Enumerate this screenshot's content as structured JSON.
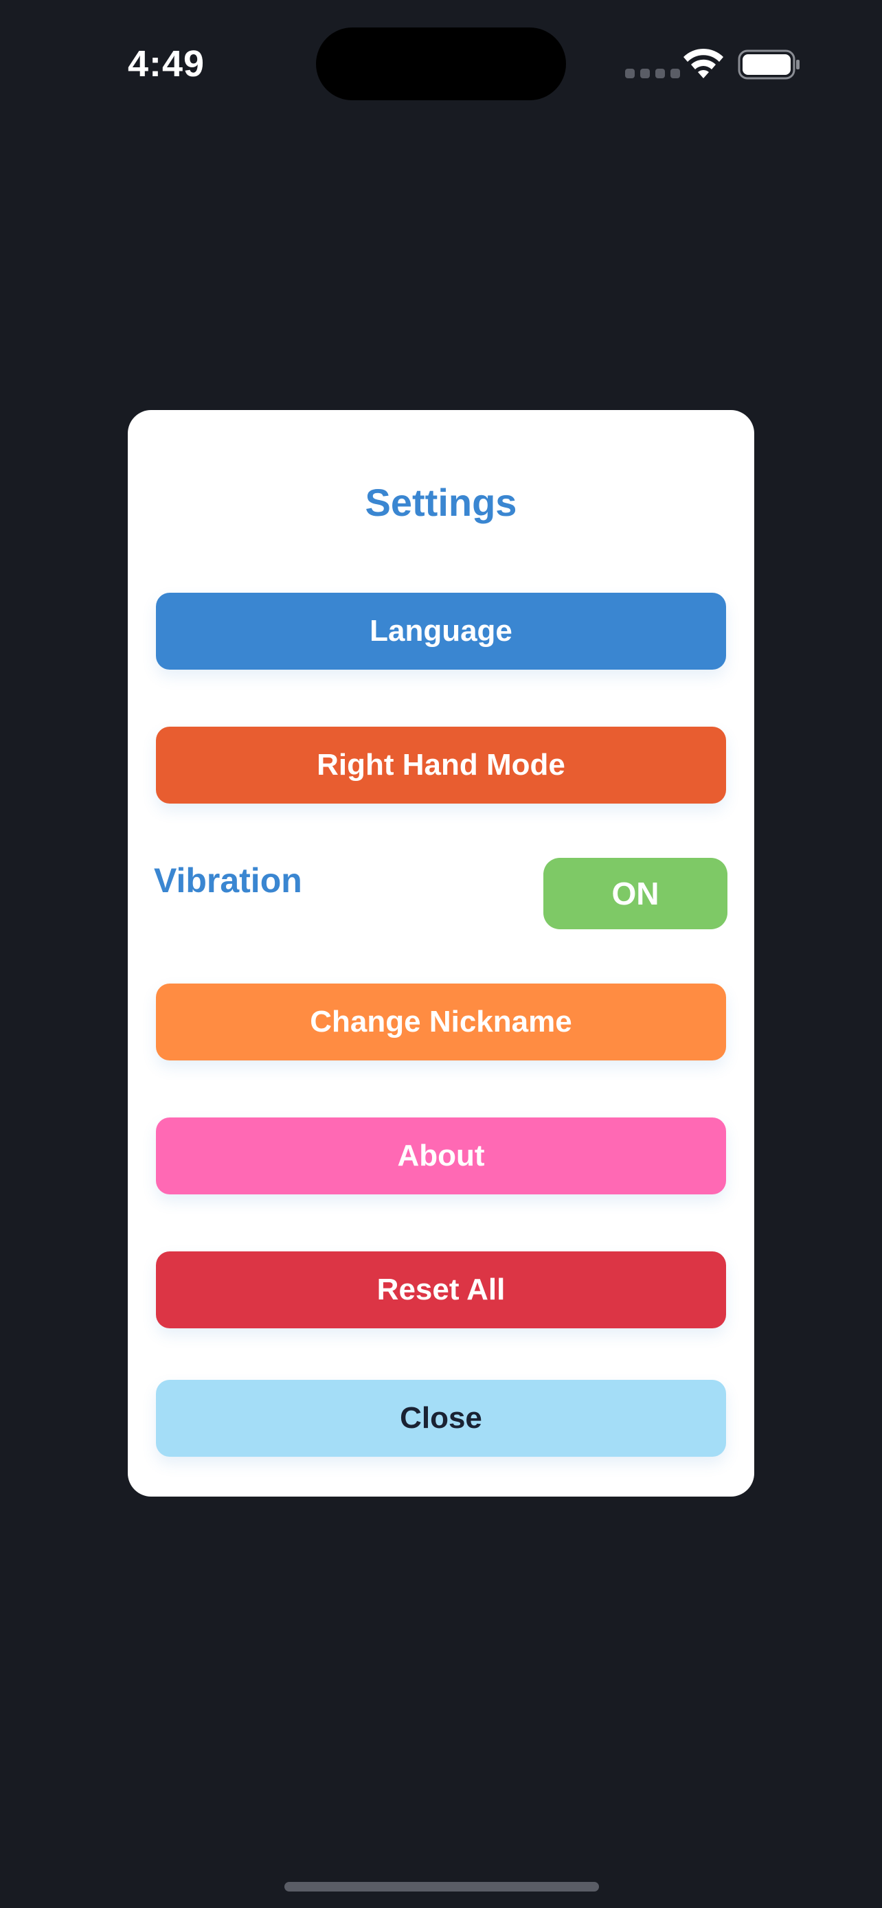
{
  "status_bar": {
    "time": "4:49"
  },
  "settings": {
    "title": "Settings",
    "buttons": [
      {
        "label": "Language",
        "color": "#3a86d1",
        "text_color": "#ffffff"
      },
      {
        "label": "Right Hand Mode",
        "color": "#e85d30",
        "text_color": "#ffffff"
      },
      {
        "label": "Change Nickname",
        "color": "#ff8c42",
        "text_color": "#ffffff"
      },
      {
        "label": "About",
        "color": "#ff69b4",
        "text_color": "#ffffff"
      },
      {
        "label": "Reset All",
        "color": "#dc3545",
        "text_color": "#ffffff"
      },
      {
        "label": "Close",
        "color": "#a4ddf7",
        "text_color": "#1a2233"
      }
    ],
    "vibration": {
      "label": "Vibration",
      "state": "ON",
      "color": "#7ec966"
    }
  },
  "colors": {
    "background": "#181b22",
    "modal": "#ffffff",
    "accent": "#3a86d1"
  },
  "icons": [
    "wifi-icon",
    "battery-icon",
    "cellular-signal-icon"
  ]
}
